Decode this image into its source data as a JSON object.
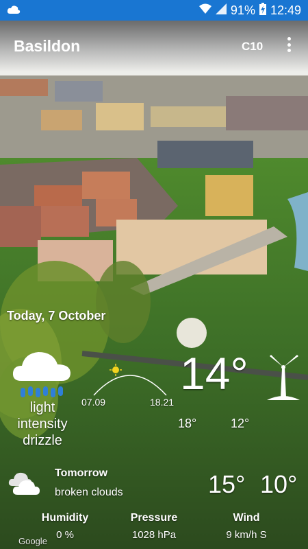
{
  "status_bar": {
    "battery": "91%",
    "time": "12:49"
  },
  "app_bar": {
    "location": "Basildon",
    "unit_button": "C10"
  },
  "today": {
    "date": "Today, 7 October",
    "condition": "light intensity drizzle",
    "sunrise": "07.09",
    "sunset": "18.21",
    "current_temp": "14°",
    "max_temp": "18°",
    "min_temp": "12°"
  },
  "tomorrow": {
    "label": "Tomorrow",
    "condition": "broken clouds",
    "max_temp": "15°",
    "min_temp": "10°"
  },
  "details": {
    "humidity_label": "Humidity",
    "humidity_value": "0 %",
    "pressure_label": "Pressure",
    "pressure_value": "1028 hPa",
    "wind_label": "Wind",
    "wind_value": "9 km/h S"
  },
  "attribution": "Google",
  "icons": {
    "status": [
      "cloud-icon",
      "wifi-icon",
      "signal-icon",
      "battery-charging-icon"
    ],
    "weather": [
      "drizzle-cloud-icon",
      "sun-arc-icon",
      "wind-turbine-icon",
      "broken-clouds-icon",
      "more-vert-icon"
    ]
  }
}
